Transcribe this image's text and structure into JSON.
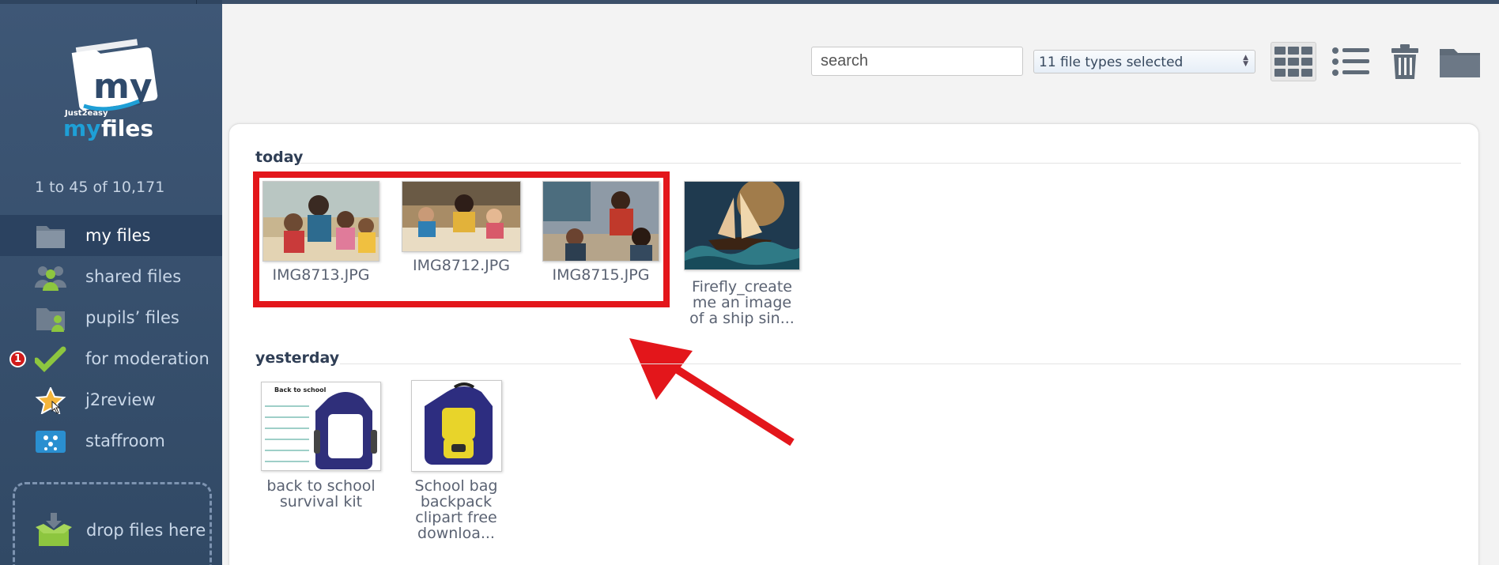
{
  "app": {
    "logo_brand": "Just2easy",
    "logo_text_1": "my",
    "logo_text_2": "files"
  },
  "sidebar": {
    "count": "1 to 45 of 10,171",
    "items": [
      {
        "label": "my files",
        "icon": "folder-icon",
        "active": true
      },
      {
        "label": "shared files",
        "icon": "shared-users-icon"
      },
      {
        "label": "pupils’ files",
        "icon": "pupils-folder-icon"
      },
      {
        "label": "for moderation",
        "icon": "checkmark-icon",
        "badge": "1"
      },
      {
        "label": "j2review",
        "icon": "star-icon"
      },
      {
        "label": "staffroom",
        "icon": "staffroom-icon"
      }
    ],
    "dropzone_label": "drop files here"
  },
  "toolbar": {
    "search_placeholder": "search",
    "file_types": "11 file types selected",
    "grid_view_icon": "grid-view-icon",
    "list_view_icon": "list-view-icon",
    "trash_icon": "trash-icon",
    "folder_icon": "folder-icon"
  },
  "groups": [
    {
      "title": "today",
      "files": [
        {
          "name": "IMG8713.JPG"
        },
        {
          "name": "IMG8712.JPG"
        },
        {
          "name": "IMG8715.JPG"
        },
        {
          "name_lines": [
            "Firefly_create",
            "me an image",
            "of a ship sin..."
          ]
        }
      ]
    },
    {
      "title": "yesterday",
      "files": [
        {
          "name_lines": [
            "back to school",
            "survival kit"
          ],
          "thumb_title": "Back to school"
        },
        {
          "name_lines": [
            "School bag",
            "backpack",
            "clipart free",
            "downloa..."
          ]
        }
      ]
    }
  ],
  "colors": {
    "sidebar": "#3e5776",
    "highlight": "#e3161b",
    "accent_green": "#8dc63f"
  }
}
